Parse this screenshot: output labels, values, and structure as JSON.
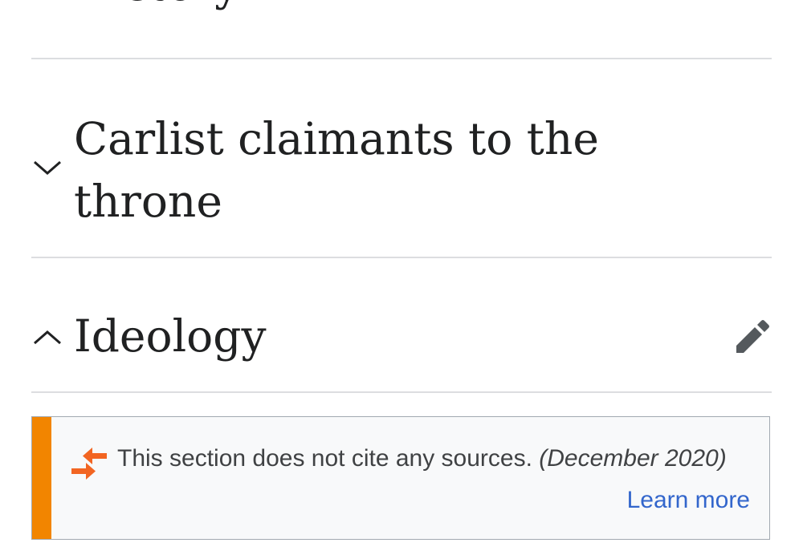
{
  "sections": {
    "history": {
      "title": "History",
      "icon": "chevron-down-icon"
    },
    "carlist": {
      "title": "Carlist claimants to the throne",
      "icon": "chevron-down-icon"
    },
    "ideology": {
      "title": "Ideology",
      "icon": "chevron-up-icon",
      "edit_icon": "pencil-icon"
    }
  },
  "notice": {
    "message": "This section does not cite any sources.",
    "date": "(December 2020)",
    "link_label": "Learn more",
    "icon": "arrows-merge-icon",
    "stripe_color": "#f28500",
    "link_color": "#3366cc"
  }
}
